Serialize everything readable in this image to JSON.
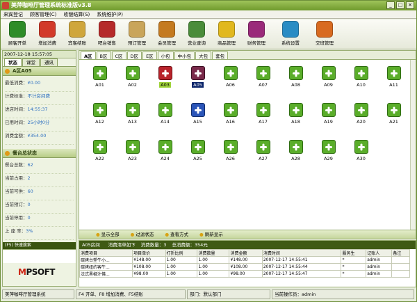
{
  "window": {
    "title": "美萍咖啡厅管理系统标准版v3.8"
  },
  "menu": [
    "来宾登记",
    "顾客管理(C)",
    "收银结算(S)",
    "系统维护(P)"
  ],
  "toolbar": [
    {
      "label": "顾客开单",
      "color": "#2e8c28"
    },
    {
      "label": "增加消费",
      "color": "#d23a2a"
    },
    {
      "label": "宾客结账",
      "color": "#cfa63c"
    },
    {
      "label": "吧台销售",
      "color": "#b52a2a"
    },
    {
      "label": "预订管理",
      "color": "#c9a55a"
    },
    {
      "label": "会员管理",
      "color": "#c47a20"
    },
    {
      "label": "营业查询",
      "color": "#4a8c3a"
    },
    {
      "label": "商品管理",
      "color": "#e1b81e"
    },
    {
      "label": "财务管理",
      "color": "#9a2a7a"
    },
    {
      "label": "系统设置",
      "color": "#2a8cc4"
    },
    {
      "label": "交班管理",
      "color": "#d86a20"
    }
  ],
  "clock": "2007-12-18 15:57:05",
  "left_tabs": [
    "状态",
    "课堂",
    "通讯"
  ],
  "room_status": {
    "title": "A区A05",
    "rows": [
      {
        "label": "最低消费：",
        "value": "¥0.00"
      },
      {
        "label": "计费标准：",
        "value": "不计房间费"
      },
      {
        "label": "进店时间：",
        "value": "14:55:37"
      },
      {
        "label": "已用时间：",
        "value": "25小时0分"
      },
      {
        "label": "消费金额：",
        "value": "¥354.00"
      }
    ]
  },
  "table_overview": {
    "title": "餐台总状态",
    "rows": [
      {
        "label": "餐台总数：",
        "value": "62"
      },
      {
        "label": "当前占用：",
        "value": "2"
      },
      {
        "label": "当前可供：",
        "value": "60"
      },
      {
        "label": "当前预订：",
        "value": "0"
      },
      {
        "label": "当前停用：",
        "value": "0"
      },
      {
        "label": "上 座 率：",
        "value": "3%"
      }
    ]
  },
  "quick_search": "(F5) 快速搜索",
  "logo": {
    "prefix": "M",
    "rest": "PSOFT",
    "accent": "#c21"
  },
  "area_tabs": [
    "A区",
    "B区",
    "C区",
    "D区",
    "E区",
    "小包",
    "中小包",
    "大包",
    "套包"
  ],
  "tables": [
    {
      "name": "A01",
      "status": "free"
    },
    {
      "name": "A02",
      "status": "free"
    },
    {
      "name": "A03",
      "status": "busy"
    },
    {
      "name": "A05",
      "status": "busy2"
    },
    {
      "name": "A06",
      "status": "free"
    },
    {
      "name": "A07",
      "status": "free"
    },
    {
      "name": "A08",
      "status": "free"
    },
    {
      "name": "A09",
      "status": "free"
    },
    {
      "name": "A10",
      "status": "free"
    },
    {
      "name": "A11",
      "status": "free"
    },
    {
      "name": "A12",
      "status": "free"
    },
    {
      "name": "A13",
      "status": "free"
    },
    {
      "name": "A14",
      "status": "free"
    },
    {
      "name": "A15",
      "status": "open"
    },
    {
      "name": "A16",
      "status": "free"
    },
    {
      "name": "A17",
      "status": "free"
    },
    {
      "name": "A18",
      "status": "free"
    },
    {
      "name": "A19",
      "status": "free"
    },
    {
      "name": "A20",
      "status": "free"
    },
    {
      "name": "A21",
      "status": "free"
    },
    {
      "name": "A22",
      "status": "free"
    },
    {
      "name": "A23",
      "status": "free"
    },
    {
      "name": "A24",
      "status": "free"
    },
    {
      "name": "A25",
      "status": "free"
    },
    {
      "name": "A26",
      "status": "free"
    },
    {
      "name": "A27",
      "status": "free"
    },
    {
      "name": "A28",
      "status": "free"
    },
    {
      "name": "A29",
      "status": "free"
    },
    {
      "name": "A30",
      "status": "free"
    }
  ],
  "actions": [
    "显示全部",
    "过滤状态",
    "查看方式",
    "刷新显示"
  ],
  "order_summary": {
    "room": "A05房间",
    "detail_label": "消费清单如下",
    "count_label": "消费数量：3",
    "total_label": "总消费额：354元"
  },
  "order_columns": [
    "消费项目",
    "项目单价",
    "打折比例",
    "消费数量",
    "消费金额",
    "消费时间",
    "服务生",
    "记账人",
    "备注"
  ],
  "orders": [
    [
      "碳烤台塑牛小...",
      "¥148.00",
      "1.00",
      "1.00",
      "¥148.00",
      "2007-12-17 14:55:41",
      "*",
      "admin",
      ""
    ],
    [
      "碳烤纽约客牛...",
      "¥108.00",
      "1.00",
      "1.00",
      "¥108.00",
      "2007-12-17 14:55:44",
      "*",
      "admin",
      ""
    ],
    [
      "法式黑椒汁佛...",
      "¥98.00",
      "1.00",
      "1.00",
      "¥98.00",
      "2007-12-17 14:55:47",
      "*",
      "admin",
      ""
    ]
  ],
  "status": {
    "app": "美萍咖啡厅管理系统",
    "hint": "F4 开单、F8 增加消费、F5结账",
    "dept": "部门：默认部门",
    "operator": "当前操作员：admin"
  }
}
